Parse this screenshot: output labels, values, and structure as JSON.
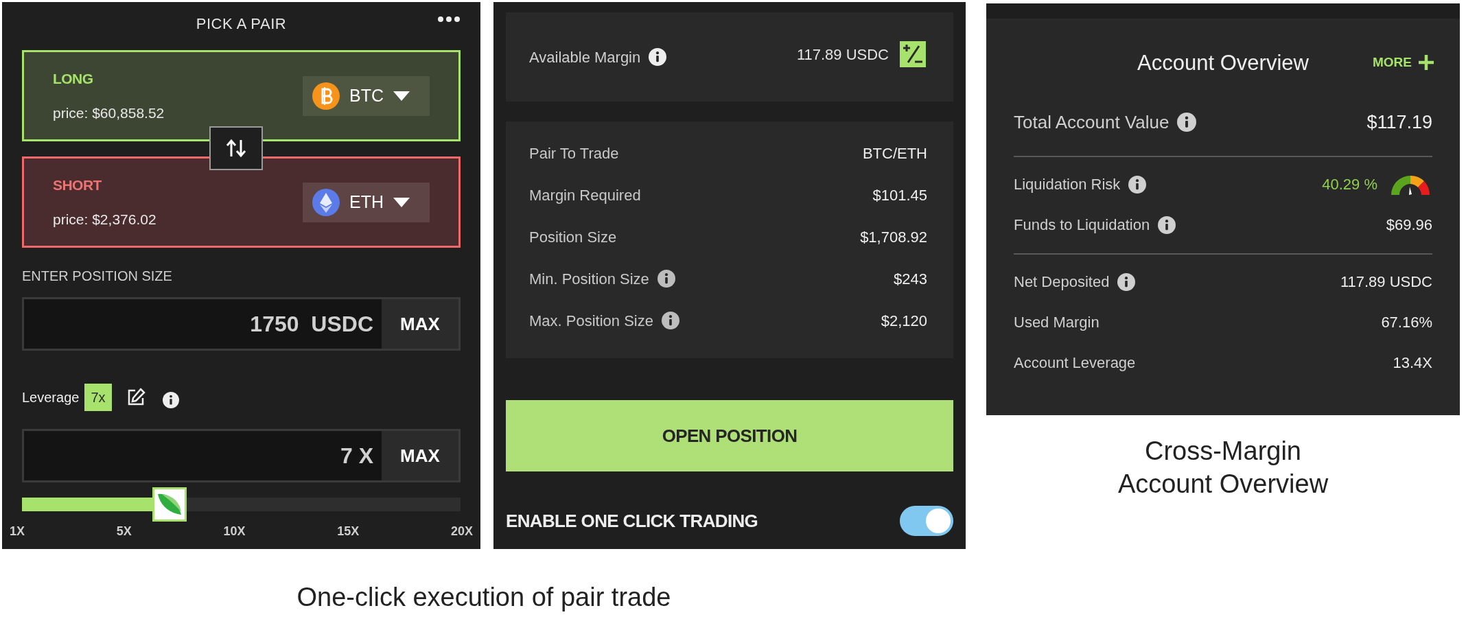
{
  "pair_panel": {
    "title": "PICK A PAIR",
    "legs": [
      {
        "kind": "long",
        "label": "LONG",
        "price": "price: $60,858.52",
        "asset": "BTC"
      },
      {
        "kind": "short",
        "label": "SHORT",
        "price": "price: $2,376.02",
        "asset": "ETH"
      }
    ],
    "position_size": {
      "label": "ENTER POSITION SIZE",
      "value": "1750  USDC",
      "max": "MAX"
    },
    "leverage": {
      "label": "Leverage",
      "badge": "7x",
      "value": "7 X",
      "max": "MAX",
      "level": 0.316,
      "ticks": [
        "1X",
        "5X",
        "10X",
        "15X",
        "20X"
      ]
    }
  },
  "order_panel": {
    "available_margin": {
      "label": "Available Margin",
      "value": "117.89 USDC"
    },
    "details": [
      {
        "label": "Pair To Trade",
        "value": "BTC/ETH",
        "info": false
      },
      {
        "label": "Margin Required",
        "value": "$101.45",
        "info": false
      },
      {
        "label": "Position Size",
        "value": "$1,708.92",
        "info": false
      },
      {
        "label": "Min. Position Size",
        "value": "$243",
        "info": true
      },
      {
        "label": "Max. Position Size",
        "value": "$2,120",
        "info": true
      }
    ],
    "submit": "OPEN POSITION",
    "one_click": {
      "label": "ENABLE ONE CLICK TRADING",
      "on": true
    }
  },
  "account_panel": {
    "title": "Account Overview",
    "more": "MORE",
    "groups": [
      [
        {
          "kind": "total",
          "label": "Total Account Value",
          "value": "$117.19",
          "info": true
        }
      ],
      [
        {
          "kind": "risk",
          "label": "Liquidation Risk",
          "value": "40.29 %",
          "info": true
        },
        {
          "kind": "plain",
          "label": "Funds to Liquidation",
          "value": "$69.96",
          "info": true
        }
      ],
      [
        {
          "kind": "plain",
          "label": "Net Deposited",
          "value": "117.89 USDC",
          "info": true
        },
        {
          "kind": "plain",
          "label": "Used Margin",
          "value": "67.16%",
          "info": false
        },
        {
          "kind": "plain",
          "label": "Account Leverage",
          "value": "13.4X",
          "info": false
        }
      ]
    ]
  },
  "captions": [
    "One-click execution of pair trade",
    "Cross-Margin\nAccount Overview"
  ]
}
